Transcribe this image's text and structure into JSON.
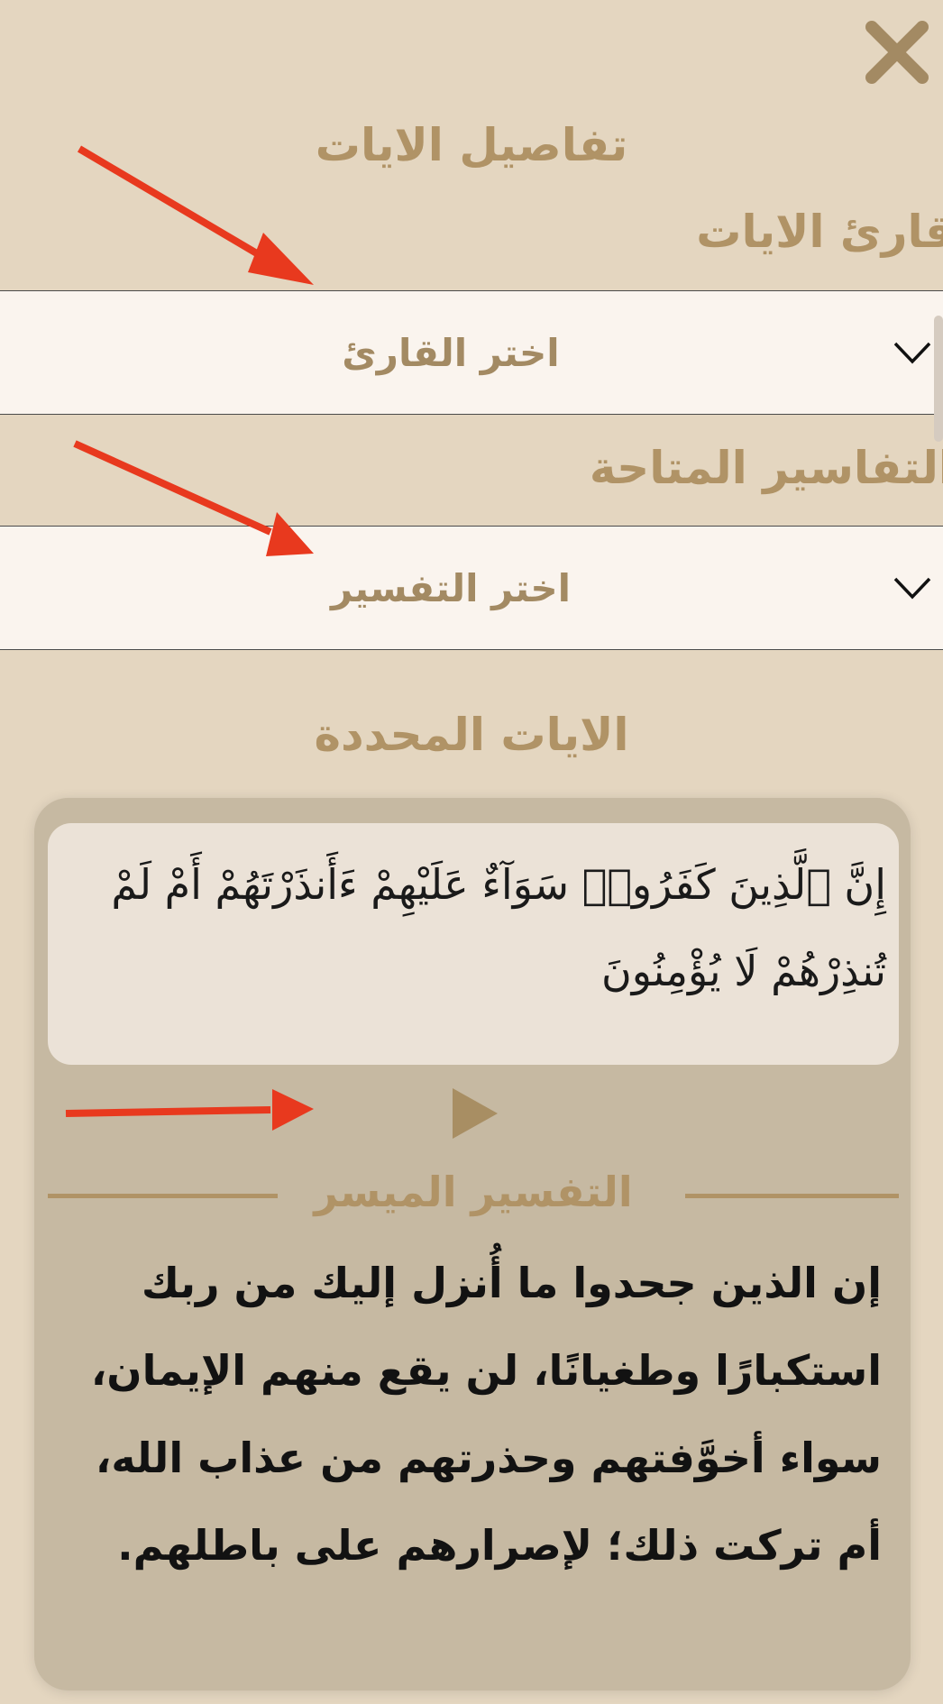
{
  "icons": {
    "close": "close-icon",
    "chevron": "chevron-down-icon",
    "play": "play-icon",
    "arrow": "red-arrow-annotation"
  },
  "colors": {
    "accent": "#b09366",
    "background": "#e4d6c0",
    "card": "#c6b9a2",
    "annotation": "#e8391e"
  },
  "header": {
    "title": "تفاصيل الايات"
  },
  "reciter": {
    "label": "قارئ الايات",
    "dropdown_placeholder": "اختر القارئ"
  },
  "tafsir_select": {
    "label": "التفاسير المتاحة",
    "dropdown_placeholder": "اختر التفسير"
  },
  "selected": {
    "title": "الايات المحددة",
    "verse": "إِنَّ ٱلَّذِينَ كَفَرُوا۟ سَوَآءٌ عَلَيْهِمْ ءَأَنذَرْتَهُمْ أَمْ لَمْ تُنذِرْهُمْ لَا يُؤْمِنُونَ",
    "tafsir_name": "التفسير الميسر",
    "tafsir_text": "إن الذين جحدوا ما أُنزل إليك من ربك استكبارًا وطغيانًا، لن يقع منهم الإيمان، سواء أخوَّفتهم وحذرتهم من عذاب الله، أم تركت ذلك؛ لإصرارهم على باطلهم."
  }
}
